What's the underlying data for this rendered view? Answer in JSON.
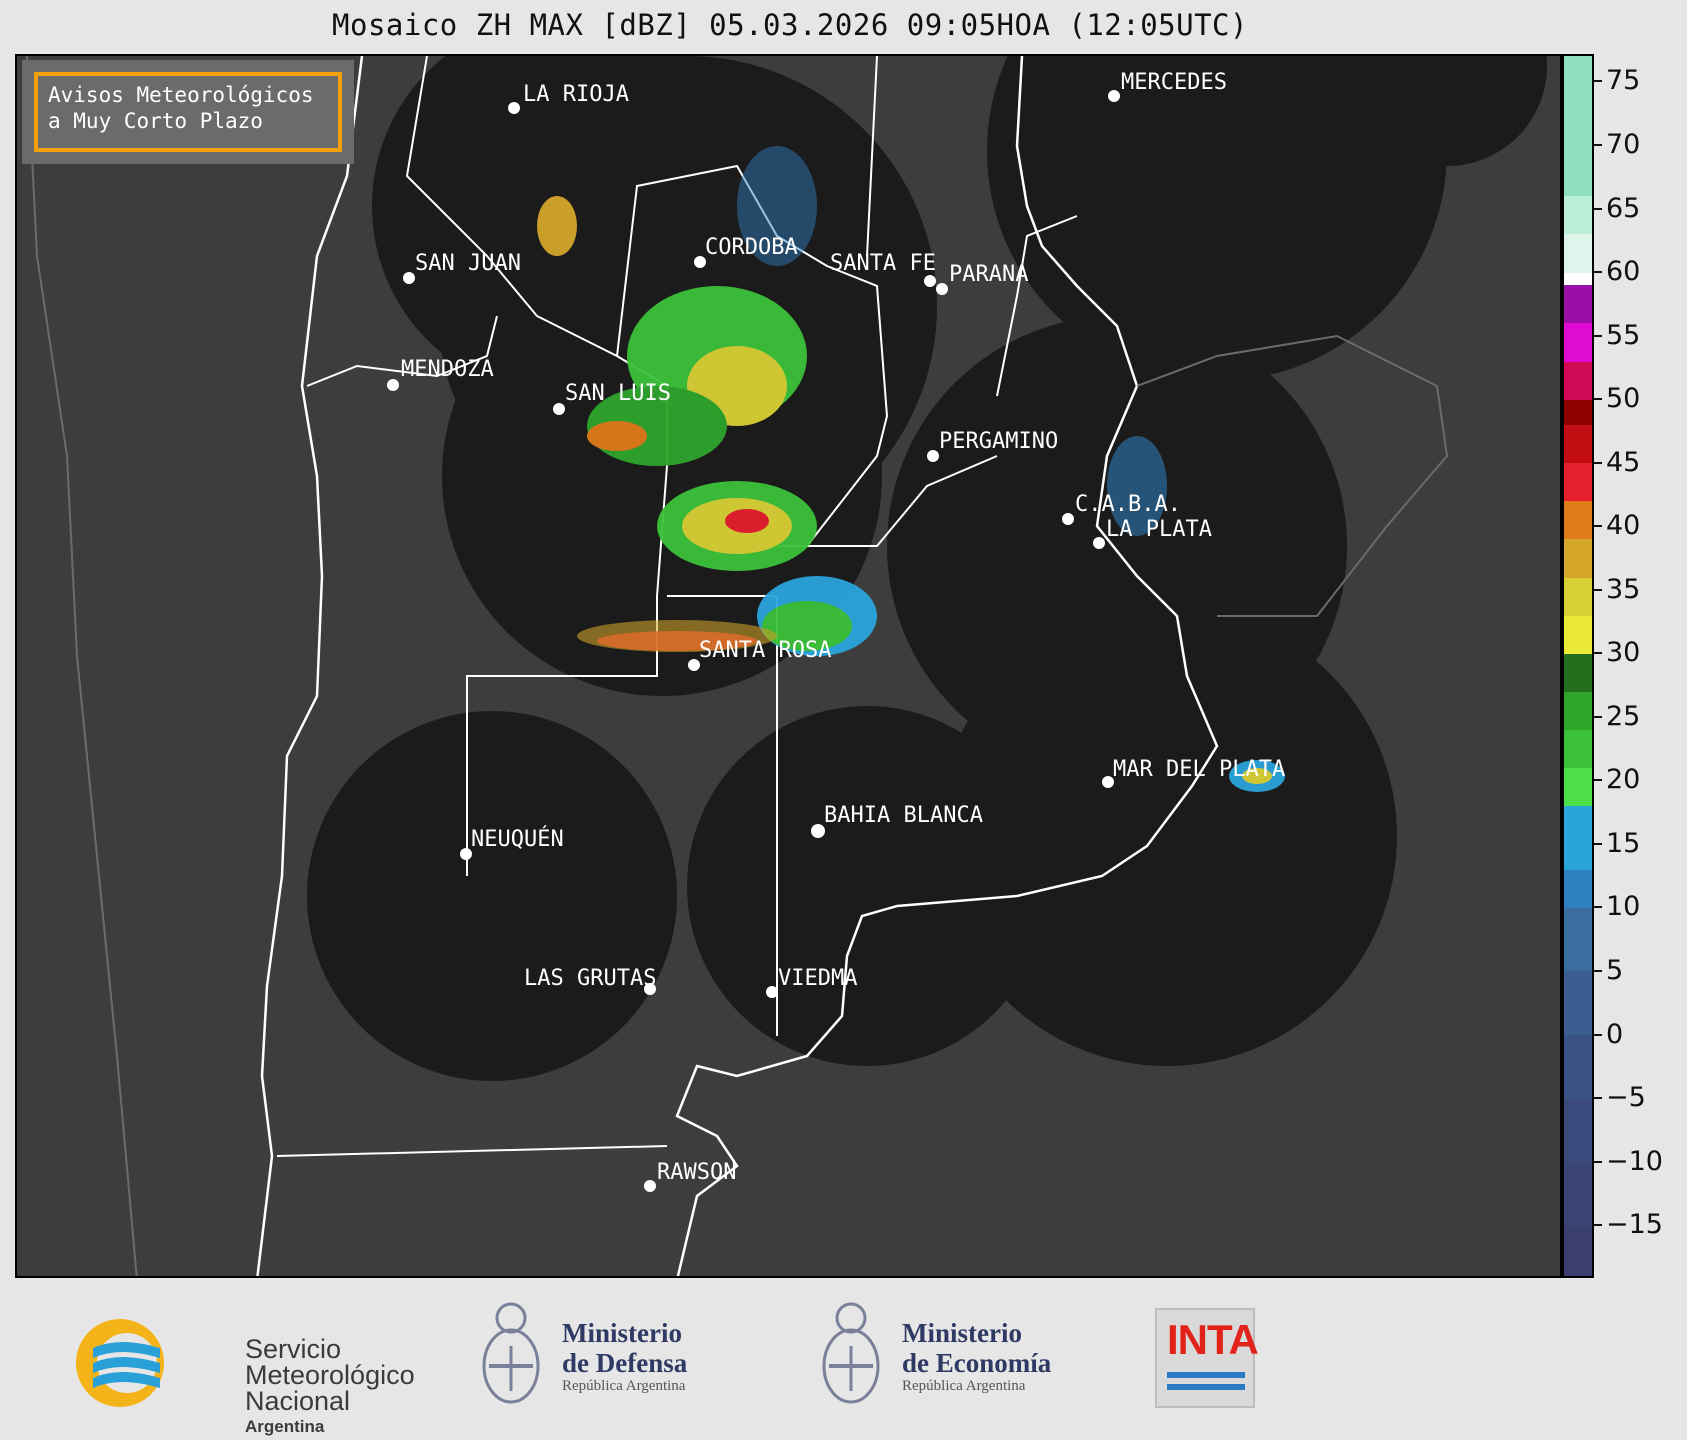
{
  "title": "Mosaico ZH MAX [dBZ] 05.03.2026 09:05HOA (12:05UTC)",
  "notice": {
    "line1": "Avisos Meteorológicos",
    "line2": "a Muy Corto Plazo"
  },
  "cities": [
    {
      "name": "LA RIOJA"
    },
    {
      "name": "CORDOBA"
    },
    {
      "name": "SAN JUAN"
    },
    {
      "name": "SANTA FE"
    },
    {
      "name": "PARANA"
    },
    {
      "name": "MENDOZA"
    },
    {
      "name": "SAN LUIS"
    },
    {
      "name": "PERGAMINO"
    },
    {
      "name": "C.A.B.A."
    },
    {
      "name": "LA PLATA"
    },
    {
      "name": "MERCEDES"
    },
    {
      "name": "SANTA ROSA"
    },
    {
      "name": "MAR DEL PLATA"
    },
    {
      "name": "BAHIA BLANCA"
    },
    {
      "name": "NEUQUÉN"
    },
    {
      "name": "LAS GRUTAS"
    },
    {
      "name": "VIEDMA"
    },
    {
      "name": "RAWSON"
    }
  ],
  "colorbar": {
    "min": -19,
    "max": 77,
    "unit": "dBZ",
    "ticks": [
      "75",
      "70",
      "65",
      "60",
      "55",
      "50",
      "45",
      "40",
      "35",
      "30",
      "25",
      "20",
      "15",
      "10",
      "5",
      "0",
      "−5",
      "−10",
      "−15"
    ],
    "tick_values": [
      75,
      70,
      65,
      60,
      55,
      50,
      45,
      40,
      35,
      30,
      25,
      20,
      15,
      10,
      5,
      0,
      -5,
      -10,
      -15
    ],
    "bands": [
      {
        "from": -19,
        "to": -15,
        "color": "#3b3f6e"
      },
      {
        "from": -15,
        "to": -10,
        "color": "#3a4475"
      },
      {
        "from": -10,
        "to": -5,
        "color": "#3a4a7d"
      },
      {
        "from": -5,
        "to": 0,
        "color": "#395385"
      },
      {
        "from": 0,
        "to": 5,
        "color": "#3a5e91"
      },
      {
        "from": 5,
        "to": 10,
        "color": "#3b6da0"
      },
      {
        "from": 10,
        "to": 13,
        "color": "#2f80bf"
      },
      {
        "from": 13,
        "to": 18,
        "color": "#2aa5dc"
      },
      {
        "from": 18,
        "to": 21,
        "color": "#4ee04a"
      },
      {
        "from": 21,
        "to": 24,
        "color": "#3cc23a"
      },
      {
        "from": 24,
        "to": 27,
        "color": "#2fa52c"
      },
      {
        "from": 27,
        "to": 30,
        "color": "#226f1e"
      },
      {
        "from": 30,
        "to": 33,
        "color": "#e9e936"
      },
      {
        "from": 33,
        "to": 36,
        "color": "#d8d035"
      },
      {
        "from": 36,
        "to": 39,
        "color": "#d4a62a"
      },
      {
        "from": 39,
        "to": 42,
        "color": "#e07b1a"
      },
      {
        "from": 42,
        "to": 45,
        "color": "#e61f2d"
      },
      {
        "from": 45,
        "to": 48,
        "color": "#c20d12"
      },
      {
        "from": 48,
        "to": 50,
        "color": "#8e0000"
      },
      {
        "from": 50,
        "to": 53,
        "color": "#d10a56"
      },
      {
        "from": 53,
        "to": 56,
        "color": "#e00bd2"
      },
      {
        "from": 56,
        "to": 59,
        "color": "#9c0ea8"
      },
      {
        "from": 59,
        "to": 60,
        "color": "#ffffff"
      },
      {
        "from": 60,
        "to": 63,
        "color": "#dff5ec"
      },
      {
        "from": 63,
        "to": 66,
        "color": "#bdeed8"
      },
      {
        "from": 66,
        "to": 77,
        "color": "#8ee0bf"
      }
    ]
  },
  "logos": {
    "smn_line1": "Servicio",
    "smn_line2": "Meteorológico",
    "smn_line3": "Nacional",
    "smn_line4": "Argentina",
    "defensa_line1": "Ministerio",
    "defensa_line2": "de Defensa",
    "defensa_line3": "República Argentina",
    "economia_line1": "Ministerio",
    "economia_line2": "de Economía",
    "economia_line3": "República Argentina",
    "inta": "INTA"
  },
  "colors": {
    "background": "#e6e6e6",
    "map_land": "#3b3b3b",
    "radar_coverage": "#1b1b1b",
    "notice_border": "#f5a00a"
  }
}
